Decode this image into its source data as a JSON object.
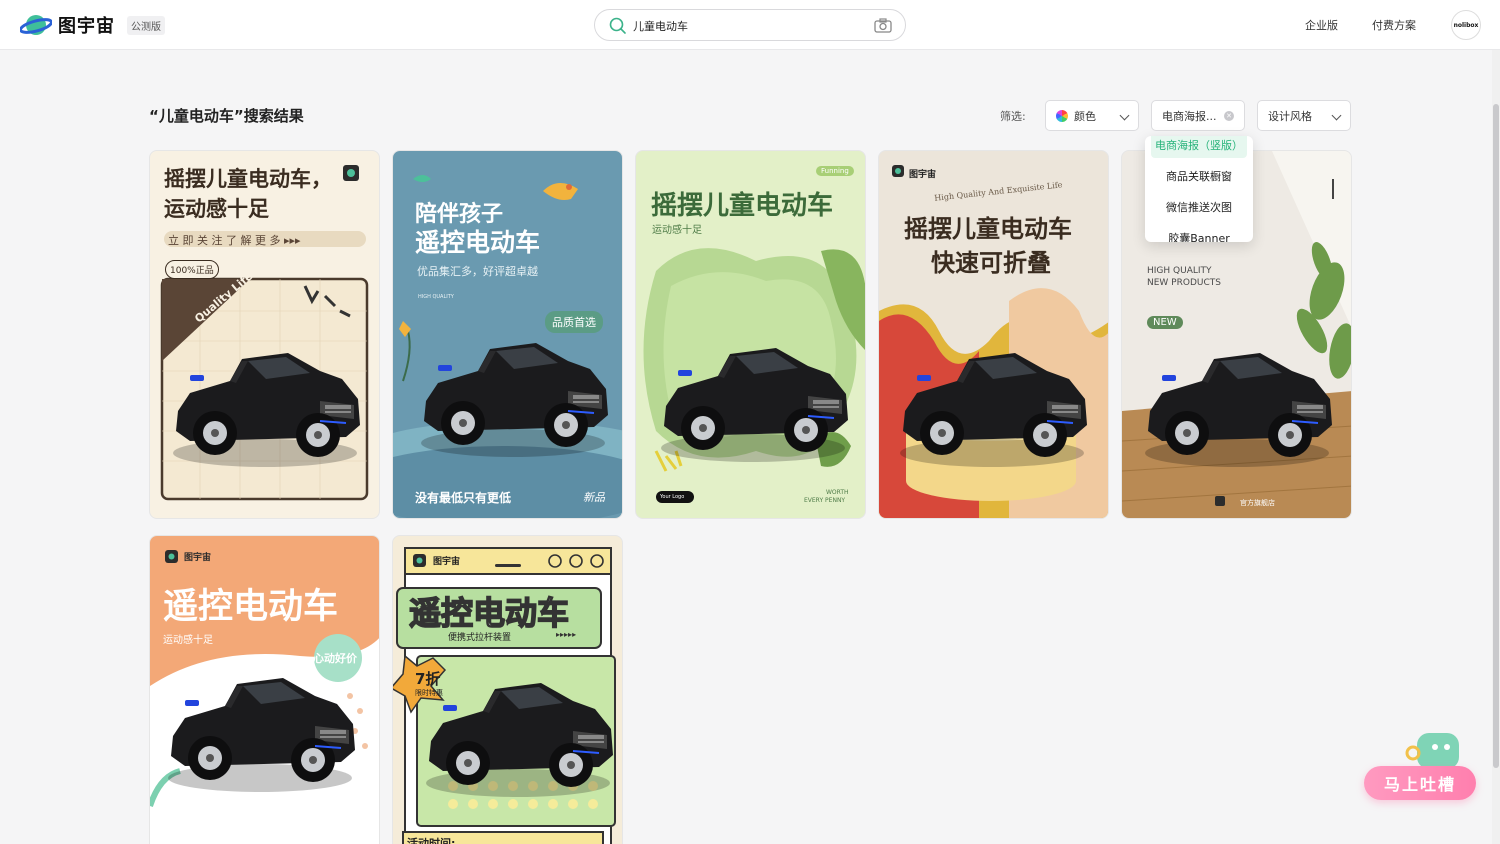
{
  "header": {
    "brand": "图宇宙",
    "beta_badge": "公测版",
    "search_value": "儿童电动车",
    "nav": [
      "企业版",
      "付费方案"
    ],
    "avatar_text": "nolibox"
  },
  "results": {
    "title": "“儿童电动车”搜索结果",
    "filter_label": "筛选:",
    "filters": [
      "颜色",
      "电商海报...",
      "设计风格"
    ]
  },
  "dropdown": {
    "items": [
      "电商海报（竖版）",
      "商品关联橱窗",
      "微信推送次图",
      "胶囊Banner"
    ]
  },
  "cards": [
    {
      "title1": "摇摆儿童电动车，",
      "title2": "运动感十足",
      "strip": "立 即 关 注   了 解 更 多 ▸▸▸",
      "seal": "100%正品",
      "ribbon": "Quality Life"
    },
    {
      "title1": "陪伴孩子",
      "title2": "遥控电动车",
      "sub": "优品集汇多，好评超卓越",
      "tiny": "HIGH QUALITY",
      "badge": "品质首选",
      "bottom": "没有最低只有更低",
      "bottom_right": "新品"
    },
    {
      "tag": "Funning",
      "title": "摇摆儿童电动车",
      "sub": "运动感十足",
      "logo": "Your Logo",
      "footer1": "WORTH",
      "footer2": "EVERY PENNY"
    },
    {
      "brand": "图宇宙",
      "arc": "High Quality And Exquisite Life",
      "title1": "摇摆儿童电动车",
      "title2": "快速可折叠"
    },
    {
      "line1": "HIGH QUALITY",
      "line2": "NEW PRODUCTS",
      "tag": "NEW",
      "store": "官方旗舰店"
    },
    {
      "brand": "图宇宙",
      "title": "遥控电动车",
      "sub": "运动感十足",
      "badge": "心动好价"
    },
    {
      "brand": "图宇宙",
      "title": "遥控电动车",
      "sub": "便携式拉杆装置",
      "arrows": "▸▸▸▸▸",
      "discount": "7折",
      "discount_sub": "限时特惠",
      "bottom": "活动时间:"
    }
  ],
  "feedback": {
    "label": "马上吐槽"
  },
  "colors": {
    "accent": "#27b37a",
    "feedback": "#ff86b4"
  }
}
